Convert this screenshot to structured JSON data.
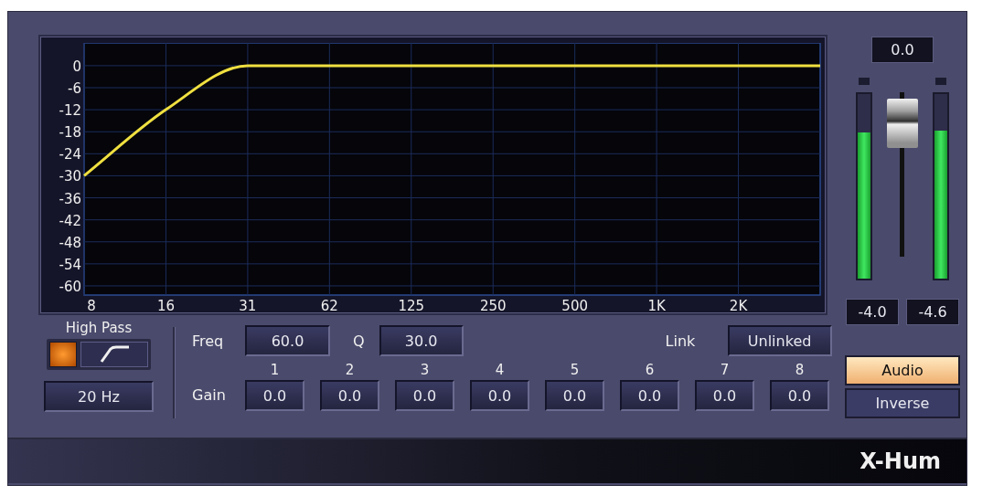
{
  "chart": {
    "chart_data": {
      "type": "line",
      "categories": [
        "8",
        "16",
        "31",
        "62",
        "125",
        "250",
        "500",
        "1K",
        "2K",
        null
      ],
      "series": [
        {
          "color": "#f0e040",
          "values": [
            -30,
            -12,
            0,
            0,
            0,
            0,
            0,
            0,
            0,
            0
          ]
        }
      ],
      "ylim": [
        -62.5,
        6.2
      ],
      "grid": true,
      "yticks": [
        {
          "value": 0,
          "label": "0"
        },
        {
          "value": -6,
          "label": "-6"
        },
        {
          "value": -12,
          "label": "-12"
        },
        {
          "value": -18,
          "label": "-18"
        },
        {
          "value": -24,
          "label": "-24"
        },
        {
          "value": -30,
          "label": "-30"
        },
        {
          "value": -36,
          "label": "-36"
        },
        {
          "value": -42,
          "label": "-42"
        },
        {
          "value": -48,
          "label": "-48"
        },
        {
          "value": -54,
          "label": "-54"
        },
        {
          "value": -60,
          "label": "-60"
        }
      ]
    }
  },
  "high_pass": {
    "label": "High Pass",
    "on": true,
    "frequency": "20 Hz"
  },
  "filter": {
    "freq_label": "Freq",
    "freq": "60.0",
    "q_label": "Q",
    "q": "30.0",
    "link_label": "Link",
    "link": "Unlinked",
    "gain_label": "Gain",
    "bands": [
      {
        "number": "1",
        "gain": "0.0"
      },
      {
        "number": "2",
        "gain": "0.0"
      },
      {
        "number": "3",
        "gain": "0.0"
      },
      {
        "number": "4",
        "gain": "0.0"
      },
      {
        "number": "5",
        "gain": "0.0"
      },
      {
        "number": "6",
        "gain": "0.0"
      },
      {
        "number": "7",
        "gain": "0.0"
      },
      {
        "number": "8",
        "gain": "0.0"
      }
    ]
  },
  "output": {
    "readout": "0.0",
    "meters": [
      {
        "level": 0.79,
        "reading": "-4.0"
      },
      {
        "level": 0.8,
        "reading": "-4.6"
      }
    ],
    "modes": [
      {
        "label": "Audio",
        "selected": true
      },
      {
        "label": "Inverse",
        "selected": false
      }
    ]
  },
  "footer": {
    "title": "X-Hum"
  }
}
